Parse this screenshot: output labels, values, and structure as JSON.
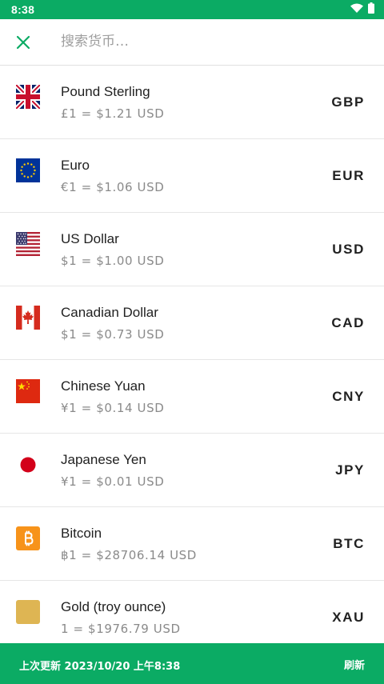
{
  "status_bar": {
    "time": "8:38"
  },
  "search": {
    "placeholder": "搜索货币…"
  },
  "currencies": [
    {
      "name": "Pound Sterling",
      "rate": "£1 = $1.21 USD",
      "code": "GBP",
      "flag_icon": "uk-flag-icon"
    },
    {
      "name": "Euro",
      "rate": "€1 = $1.06 USD",
      "code": "EUR",
      "flag_icon": "eu-flag-icon"
    },
    {
      "name": "US Dollar",
      "rate": "$1 = $1.00 USD",
      "code": "USD",
      "flag_icon": "us-flag-icon"
    },
    {
      "name": "Canadian Dollar",
      "rate": "$1 = $0.73 USD",
      "code": "CAD",
      "flag_icon": "canada-flag-icon"
    },
    {
      "name": "Chinese Yuan",
      "rate": "¥1 = $0.14 USD",
      "code": "CNY",
      "flag_icon": "china-flag-icon"
    },
    {
      "name": "Japanese Yen",
      "rate": "¥1 = $0.01 USD",
      "code": "JPY",
      "flag_icon": "japan-flag-icon"
    },
    {
      "name": "Bitcoin",
      "rate": "฿1 = $28706.14 USD",
      "code": "BTC",
      "flag_icon": "bitcoin-icon"
    },
    {
      "name": "Gold (troy ounce)",
      "rate": "1 = $1976.79 USD",
      "code": "XAU",
      "flag_icon": "gold-icon"
    }
  ],
  "footer": {
    "last_updated": "上次更新 2023/10/20 上午8:38",
    "refresh_label": "刷新"
  },
  "colors": {
    "accent": "#0bab64",
    "divider": "#e6e6e6",
    "secondary_text": "#8a8a8a"
  }
}
